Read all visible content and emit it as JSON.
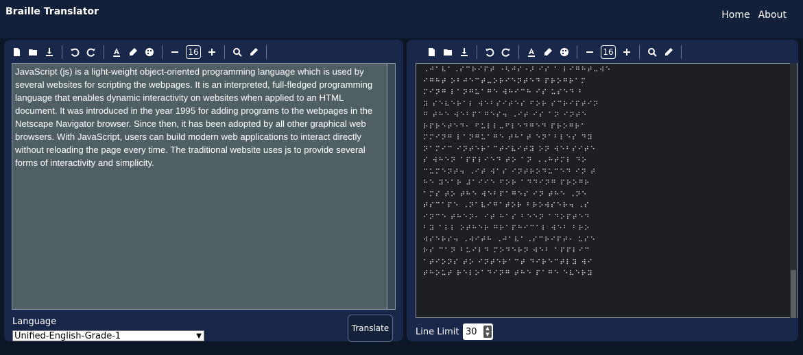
{
  "header": {
    "title": "Braille Translator",
    "nav": [
      "Home",
      "About"
    ]
  },
  "toolbar": {
    "font_size": "16",
    "icons": [
      "new-file-icon",
      "open-folder-icon",
      "download-icon",
      "undo-icon",
      "redo-icon",
      "font-color-icon",
      "highlight-icon",
      "palette-icon",
      "decrease-font-icon",
      "increase-font-icon",
      "search-icon",
      "clear-icon"
    ]
  },
  "input": {
    "text": "JavaScript (js) is a light-weight object-oriented programming language which is used by several websites for scripting the webpages. It is an interpreted, full-fledged programming language that enables dynamic interactivity on websites when applied to an HTML document. It was introduced in the year 1995 for adding programs to the webpages in the Netscape Navigator browser. Since then, it has been adopted by all other graphical web browsers. With JavaScript, users can build modern web applications to interact directly without reloading the page every time. The traditional website uses js to provide several forms of interactivity and simplicity."
  },
  "language": {
    "label": "Language",
    "selected": "Unified-English-Grade-1"
  },
  "translate_label": "Translate",
  "output": {
    "lines": [
      "⠠⠚⠁⠧⠁⠠⠎⠉⠗⠊⠏⠞ ⠐⠣⠚⠎⠐⠜ ⠊⠎ ⠁ ⠇⠊⠛⠓⠞⠤⠺⠑",
      "⠊⠛⠓⠞ ⠕⠃⠚⠑⠉⠞⠤⠕⠗⠊⠑⠝⠞⠑⠙ ⠏⠗⠕⠛⠗⠁⠍",
      "⠍⠊⠝⠛ ⠇⠁⠝⠛⠥⠁⠛⠑ ⠺⠓⠊⠉⠓ ⠊⠎ ⠥⠎⠑⠙ ⠃",
      "⠽ ⠎⠑⠧⠑⠗⠁⠇ ⠺⠑⠃⠎⠊⠞⠑⠎ ⠋⠕⠗ ⠎⠉⠗⠊⠏⠞⠊⠝",
      "⠛ ⠞⠓⠑ ⠺⠑⠃⠏⠁⠛⠑⠎⠲ ⠠⠊⠞ ⠊⠎ ⠁⠝ ⠊⠝⠞⠑",
      "⠗⠏⠗⠑⠞⠑⠙⠂ ⠋⠥⠇⠇⠤⠋⠇⠑⠙⠛⠑⠙ ⠏⠗⠕⠛⠗⠁",
      "⠍⠍⠊⠝⠛ ⠇⠁⠝⠛⠥⠁⠛⠑ ⠞⠓⠁⠞ ⠑⠝⠁⠃⠇⠑⠎ ⠙⠽",
      "⠝⠁⠍⠊⠉ ⠊⠝⠞⠑⠗⠁⠉⠞⠊⠧⠊⠞⠽ ⠕⠝ ⠺⠑⠃⠎⠊⠞⠑",
      "⠎ ⠺⠓⠑⠝ ⠁⠏⠏⠇⠊⠑⠙ ⠞⠕ ⠁⠝ ⠠⠠⠓⠞⠍⠇ ⠙⠕",
      "⠉⠥⠍⠑⠝⠞⠲ ⠠⠊⠞ ⠺⠁⠎ ⠊⠝⠞⠗⠕⠙⠥⠉⠑⠙ ⠊⠝ ⠞",
      "⠓⠑ ⠽⠑⠁⠗ ⠼⠁⠊⠊⠑ ⠋⠕⠗ ⠁⠙⠙⠊⠝⠛ ⠏⠗⠕⠛⠗",
      "⠁⠍⠎ ⠞⠕ ⠞⠓⠑ ⠺⠑⠃⠏⠁⠛⠑⠎ ⠊⠝ ⠞⠓⠑ ⠠⠝⠑",
      "⠞⠎⠉⠁⠏⠑ ⠠⠝⠁⠧⠊⠛⠁⠞⠕⠗ ⠃⠗⠕⠺⠎⠑⠗⠲ ⠠⠎",
      "⠊⠝⠉⠑ ⠞⠓⠑⠝⠂ ⠊⠞ ⠓⠁⠎ ⠃⠑⠑⠝ ⠁⠙⠕⠏⠞⠑⠙",
      "⠃⠽ ⠁⠇⠇ ⠕⠞⠓⠑⠗ ⠛⠗⠁⠏⠓⠊⠉⠁⠇ ⠺⠑⠃ ⠃⠗⠕",
      "⠺⠎⠑⠗⠎⠲ ⠠⠺⠊⠞⠓ ⠠⠚⠁⠧⠁⠠⠎⠉⠗⠊⠏⠞⠂ ⠥⠎⠑",
      "⠗⠎ ⠉⠁⠝ ⠃⠥⠊⠇⠙ ⠍⠕⠙⠑⠗⠝ ⠺⠑⠃ ⠁⠏⠏⠇⠊⠉",
      "⠁⠞⠊⠕⠝⠎ ⠞⠕ ⠊⠝⠞⠑⠗⠁⠉⠞ ⠙⠊⠗⠑⠉⠞⠇⠽ ⠺⠊",
      "⠞⠓⠕⠥⠞ ⠗⠑⠇⠕⠁⠙⠊⠝⠛ ⠞⠓⠑ ⠏⠁⠛⠑ ⠑⠧⠑⠗⠽"
    ]
  },
  "line_limit": {
    "label": "Line Limit",
    "value": "30"
  },
  "colors": {
    "page_bg": "#0d1626",
    "panel_bg": "#19284a",
    "editor_bg": "#4f5f64",
    "output_bg": "#1d1f22"
  }
}
